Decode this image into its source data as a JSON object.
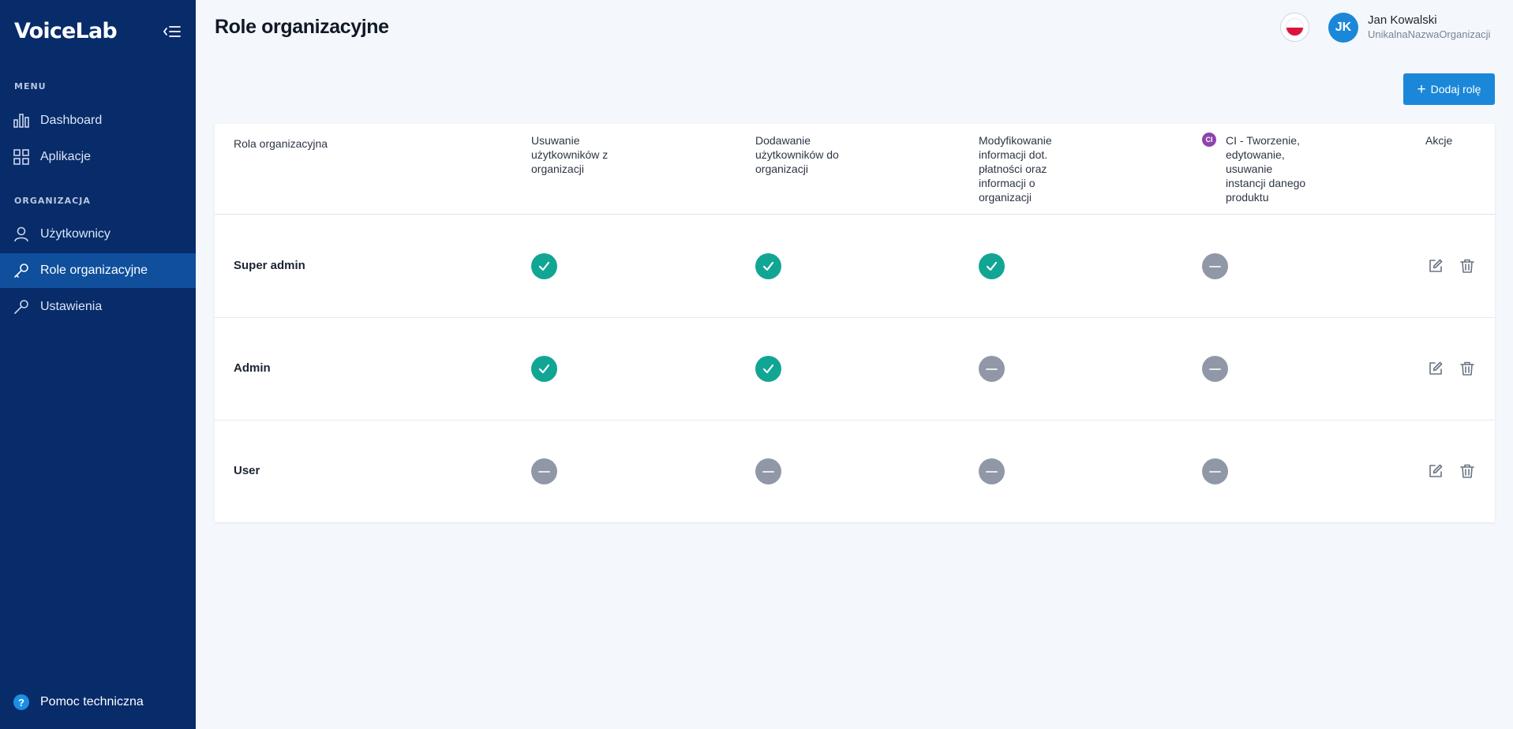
{
  "sidebar": {
    "logo": "VoiceLab",
    "menu_label": "MENU",
    "org_label": "ORGANIZACJA",
    "items": [
      {
        "label": "Dashboard",
        "icon": "bar-chart-icon"
      },
      {
        "label": "Aplikacje",
        "icon": "grid-icon"
      },
      {
        "label": "Użytkownicy",
        "icon": "user-icon"
      },
      {
        "label": "Role organizacyjne",
        "icon": "key-icon",
        "active": true
      },
      {
        "label": "Ustawienia",
        "icon": "wrench-icon"
      }
    ],
    "help_label": "Pomoc techniczna"
  },
  "header": {
    "title": "Role organizacyjne",
    "user_initials": "JK",
    "user_name": "Jan Kowalski",
    "user_org": "UnikalnaNazwaOrganizacji"
  },
  "add_button_label": "Dodaj rolę",
  "table": {
    "headers": {
      "role": "Rola organizacyjna",
      "p1": [
        "Usuwanie",
        "użytkowników z",
        "organizacji"
      ],
      "p2": [
        "Dodawanie",
        "użytkowników do",
        "organizacji"
      ],
      "p3": [
        "Modyfikowanie",
        "informacji dot.",
        "płatności oraz",
        "informacji o",
        "organizacji"
      ],
      "p4_badge": "CI",
      "p4": [
        "CI - Tworzenie,",
        "edytowanie,",
        "usuwanie",
        "instancji danego",
        "produktu"
      ],
      "actions": "Akcje"
    },
    "rows": [
      {
        "name": "Super admin",
        "perms": [
          true,
          true,
          true,
          false
        ]
      },
      {
        "name": "Admin",
        "perms": [
          true,
          true,
          false,
          false
        ]
      },
      {
        "name": "User",
        "perms": [
          false,
          false,
          false,
          false
        ]
      }
    ]
  },
  "colors": {
    "sidebar": "#082b69",
    "sidebar_active": "#0f4f9c",
    "accent": "#1b87d9",
    "granted": "#11a594",
    "denied": "#9097a6"
  }
}
